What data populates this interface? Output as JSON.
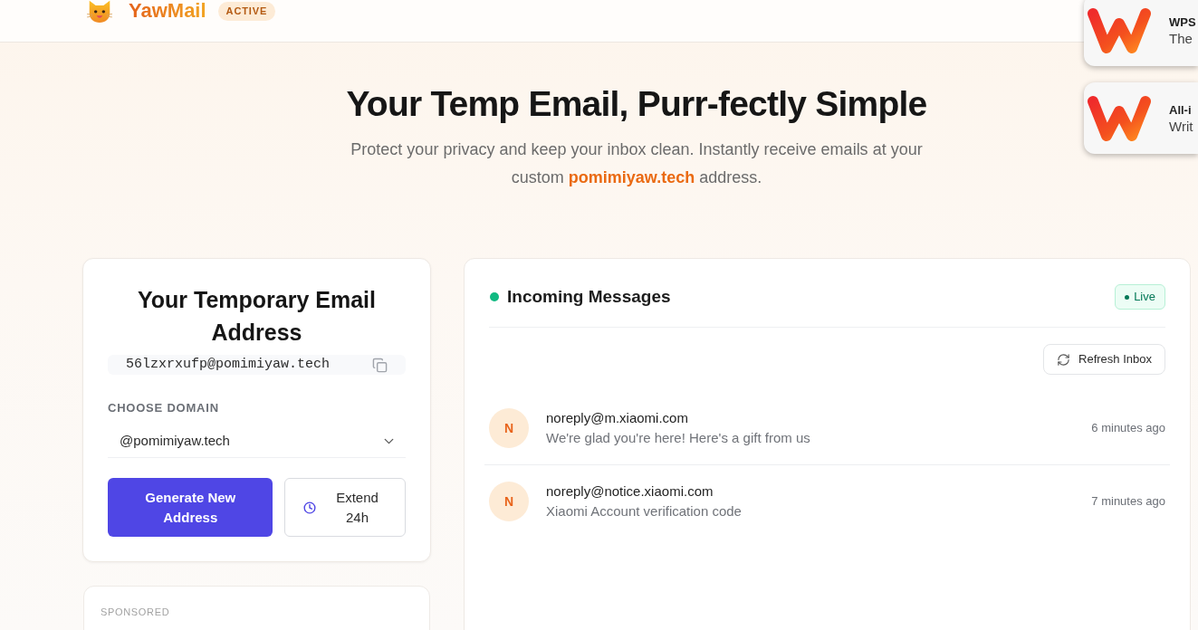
{
  "header": {
    "brand": "YawMail",
    "status_badge": "ACTIVE"
  },
  "notifications": [
    {
      "title": "WPS",
      "text": "The"
    },
    {
      "title": "All-i",
      "text": "Writ"
    }
  ],
  "hero": {
    "title": "Your Temp Email, Purr-fectly Simple",
    "subtitle": "Protect your privacy and keep your inbox clean. Instantly receive emails at your custom **pomimiyaw.tech** address."
  },
  "address_card": {
    "title": "Your Temporary Email Address",
    "email": "56lzxrxufp@pomimiyaw.tech",
    "domain_label": "CHOOSE DOMAIN",
    "domain": "@pomimiyaw.tech",
    "generate_button": "Generate New Address",
    "extend_button": "Extend 24h"
  },
  "sponsored": {
    "label": "SPONSORED"
  },
  "inbox": {
    "title": "Incoming Messages",
    "live_badge": "Live",
    "refresh_button": "Refresh Inbox",
    "messages": [
      {
        "avatar": "N",
        "sender": "noreply@m.xiaomi.com",
        "subject": "We're glad you're here! Here's a gift from us",
        "time": "6 minutes ago"
      },
      {
        "avatar": "N",
        "sender": "noreply@notice.xiaomi.com",
        "subject": "Xiaomi Account verification code",
        "time": "7 minutes ago"
      }
    ]
  }
}
